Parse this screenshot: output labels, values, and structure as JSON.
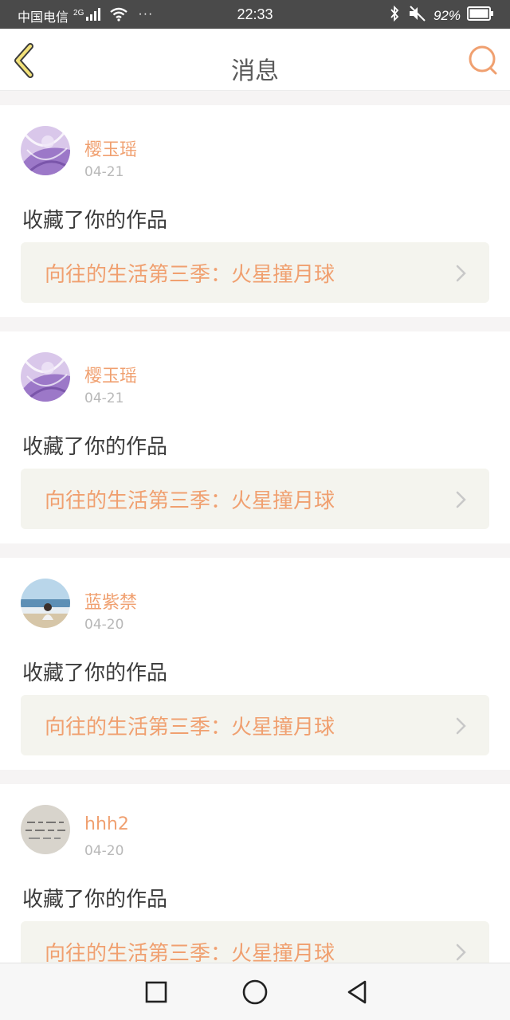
{
  "status_bar": {
    "carrier": "中国电信",
    "network": "2G",
    "more": "···",
    "time": "22:33",
    "battery": "92%"
  },
  "header": {
    "title": "消息",
    "back_icon": "chevron-left-icon",
    "search_icon": "search-icon",
    "accent_color": "#f0a070"
  },
  "messages": [
    {
      "username": "樱玉瑶",
      "date": "04-21",
      "action": "收藏了你的作品",
      "work_title": "向往的生活第三季：火星撞月球",
      "avatar": "purple-lace-avatar"
    },
    {
      "username": "樱玉瑶",
      "date": "04-21",
      "action": "收藏了你的作品",
      "work_title": "向往的生活第三季：火星撞月球",
      "avatar": "purple-lace-avatar"
    },
    {
      "username": "蓝紫禁",
      "date": "04-20",
      "action": "收藏了你的作品",
      "work_title": "向往的生活第三季：火星撞月球",
      "avatar": "beach-avatar"
    },
    {
      "username": "hhh2",
      "date": "04-20",
      "action": "收藏了你的作品",
      "work_title": "向往的生活第三季：火星撞月球",
      "avatar": "handwriting-avatar"
    }
  ],
  "nav_bar": {
    "recents_icon": "square-icon",
    "home_icon": "circle-icon",
    "back_icon": "triangle-back-icon"
  }
}
